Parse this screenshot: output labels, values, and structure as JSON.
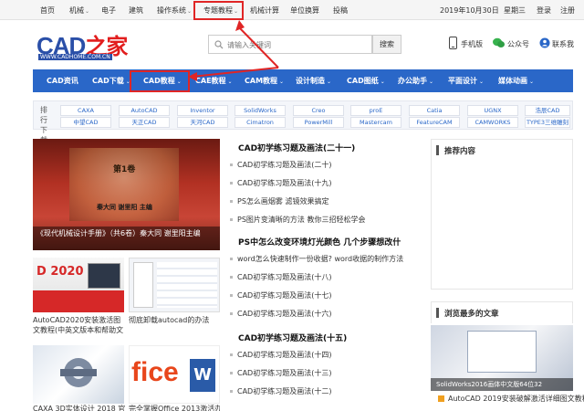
{
  "topbar": {
    "links": [
      "首页",
      "机械",
      "电子",
      "建筑",
      "操作系统",
      "专题教程",
      "机械计算",
      "单位换算",
      "投稿"
    ],
    "date": "2019年10月30日",
    "weekday": "星期三",
    "login": "登录",
    "register": "注册"
  },
  "header": {
    "logo_main": "CAD",
    "logo_zh": "之家",
    "logo_sub": "WWW.CADHOME.COM.CN",
    "search_placeholder": "请输入关键词",
    "search_button": "搜索",
    "mobile": "手机版",
    "wechat": "公众号",
    "contact": "联系我"
  },
  "nav": [
    {
      "label": "CAD资讯",
      "dropdown": false
    },
    {
      "label": "CAD下载",
      "dropdown": true
    },
    {
      "label": "CAD教程",
      "dropdown": true
    },
    {
      "label": "CAE教程",
      "dropdown": true
    },
    {
      "label": "CAM教程",
      "dropdown": true
    },
    {
      "label": "设计制造",
      "dropdown": true
    },
    {
      "label": "CAD图纸",
      "dropdown": true
    },
    {
      "label": "办公助手",
      "dropdown": true
    },
    {
      "label": "平面设计",
      "dropdown": true
    },
    {
      "label": "媒体动画",
      "dropdown": true
    }
  ],
  "tags": {
    "label": "排行下载",
    "row1": [
      "CAXA",
      "AutoCAD",
      "Inventor",
      "SolidWorks",
      "Creo",
      "proE",
      "Catia",
      "UGNX",
      "浩辰CAD"
    ],
    "row2": [
      "中望CAD",
      "天正CAD",
      "天河CAD",
      "Cimatron",
      "PowerMill",
      "Mastercam",
      "FeatureCAM",
      "CAMWORKS",
      "TYPE3三维雕刻"
    ]
  },
  "feature": {
    "caption": "《现代机械设计手册》（共6卷）秦大同 谢里阳主编",
    "volume": "第1卷",
    "authors": "秦大同 谢里阳 主编"
  },
  "thumbs": [
    {
      "caption": "AutoCAD2020安装激活图文教程(中英文版本和帮助文",
      "overlay": "D 2020"
    },
    {
      "caption": "彻底卸载autocad的办法"
    },
    {
      "caption": "CAXA 3D实体设计 2018 官"
    },
    {
      "caption": "完全掌握Office 2013激活办",
      "overlay": "fice"
    }
  ],
  "middle": {
    "groups": [
      {
        "head": "CAD初学练习题及画法(二十一)",
        "items": [
          "CAD初学练习题及画法(二十)",
          "CAD初学练习题及画法(十九)",
          "PS怎么画烟雾 滤镜效果搞定",
          "PS图片变清晰的方法 教你三招轻松学会"
        ]
      },
      {
        "head": "PS中怎么改变环境灯光颜色 几个步骤想改什",
        "items": [
          "word怎么快速制作一份收据? word收据的制作方法",
          "CAD初学练习题及画法(十八)",
          "CAD初学练习题及画法(十七)",
          "CAD初学练习题及画法(十六)"
        ]
      },
      {
        "head": "CAD初学练习题及画法(十五)",
        "items": [
          "CAD初学练习题及画法(十四)",
          "CAD初学练习题及画法(十三)",
          "CAD初学练习题及画法(十二)"
        ]
      }
    ]
  },
  "right": {
    "rec_title": "推荐内容",
    "hot_title": "浏览最多的文章",
    "hot_image_caption": "SolidWorks2016画体中文版64位32",
    "hot_item": "AutoCAD 2019安装破解激活详细图文教程"
  }
}
